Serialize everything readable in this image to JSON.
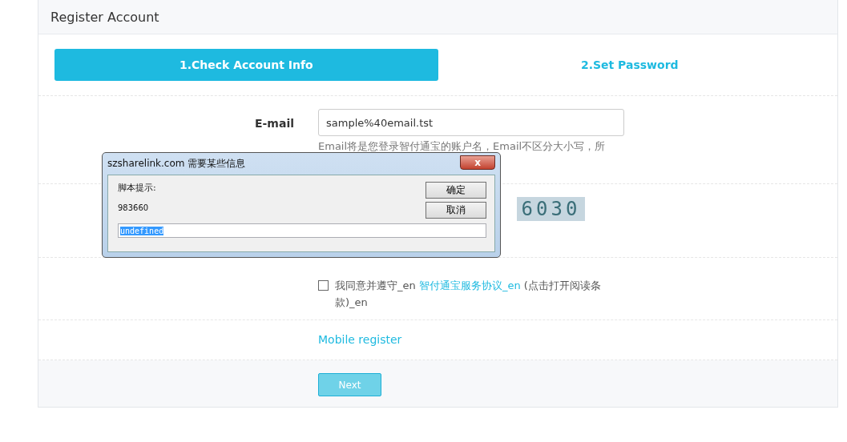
{
  "page": {
    "title": "Register Account"
  },
  "steps": [
    {
      "label": "1.Check Account Info",
      "selected": true
    },
    {
      "label": "2.Set Password",
      "selected": false
    }
  ],
  "email": {
    "label": "E-mail",
    "value": "sample%40email.tst",
    "hint": "Email将是您登录智付通宝的账户名，Email不区分大小写，所"
  },
  "captcha": {
    "code": "6030"
  },
  "agreement": {
    "checked": false,
    "prefix": "我同意并遵守_en",
    "link": "智付通宝服务协议_en",
    "suffix": "(点击打开阅读条款)_en"
  },
  "mobile_register": "Mobile register",
  "next_button": {
    "label": "Next",
    "disabled": true
  },
  "dialog": {
    "title": "szsharelink.com 需要某些信息",
    "close": "x",
    "prompt": "脚本提示:",
    "message": "983660",
    "ok": "确定",
    "cancel": "取消",
    "value": "undefined"
  }
}
